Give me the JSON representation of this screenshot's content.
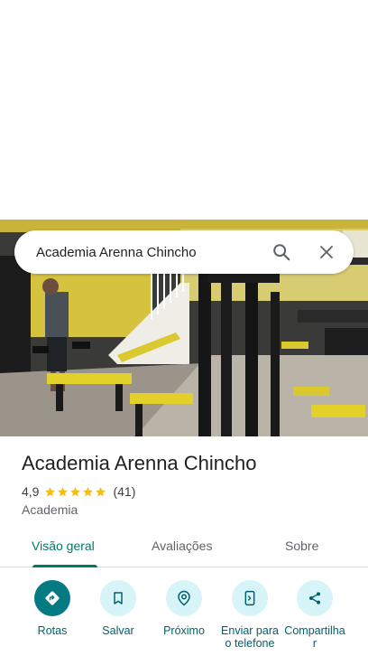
{
  "search": {
    "query": "Academia Arenna Chincho"
  },
  "place": {
    "name": "Academia Arenna Chincho",
    "rating": "4,9",
    "stars": 5,
    "review_count": "(41)",
    "category": "Academia"
  },
  "tabs": [
    {
      "label": "Visão geral",
      "active": true
    },
    {
      "label": "Avaliações",
      "active": false
    },
    {
      "label": "Sobre",
      "active": false
    }
  ],
  "actions": [
    {
      "label": "Rotas",
      "icon": "directions-icon"
    },
    {
      "label": "Salvar",
      "icon": "bookmark-icon"
    },
    {
      "label": "Próximo",
      "icon": "nearby-icon"
    },
    {
      "label": "Enviar para o telefone",
      "icon": "send-to-phone-icon"
    },
    {
      "label": "Compartilhar",
      "icon": "share-icon"
    }
  ],
  "colors": {
    "accent": "#00796b",
    "primary_action": "#047a82",
    "action_bg": "#d7f4f9",
    "star": "#fbbc04"
  }
}
